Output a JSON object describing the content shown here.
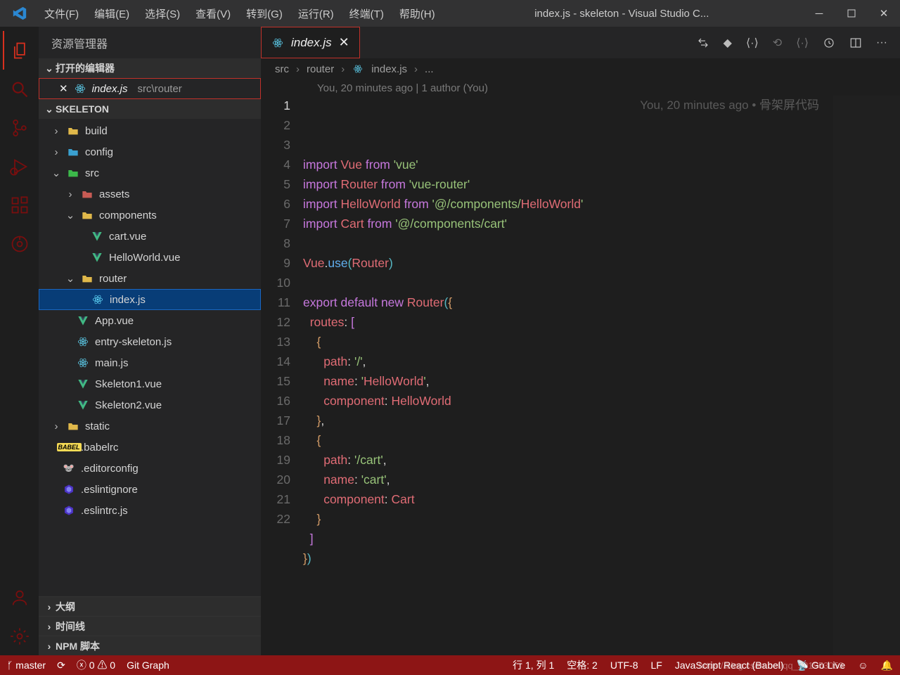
{
  "titlebar": {
    "menus": [
      "文件(F)",
      "编辑(E)",
      "选择(S)",
      "查看(V)",
      "转到(G)",
      "运行(R)",
      "终端(T)",
      "帮助(H)"
    ],
    "title": "index.js - skeleton - Visual Studio C..."
  },
  "sidebar": {
    "header": "资源管理器",
    "openEditorsTitle": "打开的编辑器",
    "openEditor": {
      "name": "index.js",
      "path": "src\\router"
    },
    "projectTitle": "SKELETON",
    "outline": "大纲",
    "timeline": "时间线",
    "npm": "NPM 脚本",
    "tree": [
      {
        "depth": 0,
        "chev": "›",
        "icon": "folder",
        "label": "build",
        "color": "#e0b84a"
      },
      {
        "depth": 0,
        "chev": "›",
        "icon": "folder",
        "label": "config",
        "color": "#3aa0d0"
      },
      {
        "depth": 0,
        "chev": "⌄",
        "icon": "folder",
        "label": "src",
        "color": "#3cb84a"
      },
      {
        "depth": 1,
        "chev": "›",
        "icon": "folder",
        "label": "assets",
        "color": "#c75b54"
      },
      {
        "depth": 1,
        "chev": "⌄",
        "icon": "folder",
        "label": "components",
        "color": "#e0b84a"
      },
      {
        "depth": 2,
        "chev": "",
        "icon": "vue",
        "label": "cart.vue"
      },
      {
        "depth": 2,
        "chev": "",
        "icon": "vue",
        "label": "HelloWorld.vue"
      },
      {
        "depth": 1,
        "chev": "⌄",
        "icon": "folder",
        "label": "router",
        "color": "#e0b84a"
      },
      {
        "depth": 2,
        "chev": "",
        "icon": "react",
        "label": "index.js",
        "sel": true
      },
      {
        "depth": 1,
        "chev": "",
        "icon": "vue",
        "label": "App.vue"
      },
      {
        "depth": 1,
        "chev": "",
        "icon": "react",
        "label": "entry-skeleton.js"
      },
      {
        "depth": 1,
        "chev": "",
        "icon": "react",
        "label": "main.js"
      },
      {
        "depth": 1,
        "chev": "",
        "icon": "vue",
        "label": "Skeleton1.vue"
      },
      {
        "depth": 1,
        "chev": "",
        "icon": "vue",
        "label": "Skeleton2.vue"
      },
      {
        "depth": 0,
        "chev": "›",
        "icon": "folder",
        "label": "static",
        "color": "#e0b84a"
      },
      {
        "depth": 0,
        "chev": "",
        "icon": "babel",
        "label": ".babelrc"
      },
      {
        "depth": 0,
        "chev": "",
        "icon": "editor",
        "label": ".editorconfig"
      },
      {
        "depth": 0,
        "chev": "",
        "icon": "eslint",
        "label": ".eslintignore"
      },
      {
        "depth": 0,
        "chev": "",
        "icon": "eslint",
        "label": ".eslintrc.js"
      }
    ]
  },
  "tab": {
    "name": "index.js"
  },
  "breadcrumb": {
    "src": "src",
    "router": "router",
    "file": "index.js",
    "ell": "..."
  },
  "blame": {
    "top": "You, 20 minutes ago | 1 author (You)",
    "inline": "You, 20 minutes ago • 骨架屏代码"
  },
  "code": {
    "lines": [
      "import Vue from 'vue'",
      "import Router from 'vue-router'",
      "import HelloWorld from '@/components/HelloWorld'",
      "import Cart from '@/components/cart'",
      "",
      "Vue.use(Router)",
      "",
      "export default new Router({",
      "  routes: [",
      "    {",
      "      path: '/',",
      "      name: 'HelloWorld',",
      "      component: HelloWorld",
      "    },",
      "    {",
      "      path: '/cart',",
      "      name: 'cart',",
      "      component: Cart",
      "    }",
      "  ]",
      "})",
      ""
    ]
  },
  "status": {
    "branch": "master",
    "errors": "0",
    "warnings": "0",
    "gitgraph": "Git Graph",
    "pos": "行 1, 列 1",
    "spaces": "空格: 2",
    "encoding": "UTF-8",
    "eol": "LF",
    "lang": "JavaScript React (Babel)",
    "golive": "Go Live",
    "watermark": "https://blog.csdn.net/qq_501953053"
  }
}
